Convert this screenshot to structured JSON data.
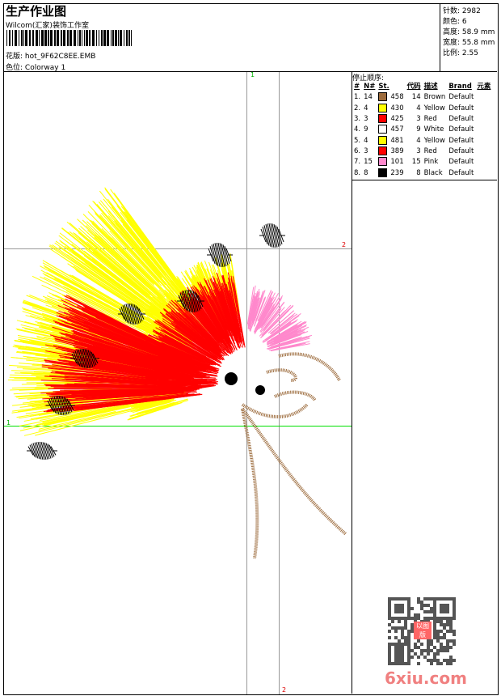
{
  "header": {
    "title": "生产作业图",
    "company": "Wilcom(汇家)装饰工作室",
    "design_label": "花版:",
    "design_value": "hot_9F62C8EE.EMB",
    "colorway_label": "色位:",
    "colorway_value": "Colorway 1"
  },
  "info": [
    {
      "label": "针数:",
      "value": "2982"
    },
    {
      "label": "颜色:",
      "value": "6"
    },
    {
      "label": "高度:",
      "value": "58.9 mm"
    },
    {
      "label": "宽度:",
      "value": "55.8 mm"
    },
    {
      "label": "比例:",
      "value": "2.55"
    }
  ],
  "stops": {
    "title": "停止顺序:",
    "columns": [
      "#",
      "N#",
      "St.",
      "代码",
      "描述",
      "Brand",
      "元素"
    ],
    "rows": [
      {
        "n": "1.",
        "needle": "14",
        "color": "#9c6b3c",
        "st": "458",
        "code": "14",
        "desc": "Brown",
        "brand": "Default"
      },
      {
        "n": "2.",
        "needle": "4",
        "color": "#ffff00",
        "st": "430",
        "code": "4",
        "desc": "Yellow",
        "brand": "Default"
      },
      {
        "n": "3.",
        "needle": "3",
        "color": "#ff0000",
        "st": "425",
        "code": "3",
        "desc": "Red",
        "brand": "Default"
      },
      {
        "n": "4.",
        "needle": "9",
        "color": "#ffffff",
        "st": "457",
        "code": "9",
        "desc": "White",
        "brand": "Default"
      },
      {
        "n": "5.",
        "needle": "4",
        "color": "#ffff00",
        "st": "481",
        "code": "4",
        "desc": "Yellow",
        "brand": "Default"
      },
      {
        "n": "6.",
        "needle": "3",
        "color": "#ff0000",
        "st": "389",
        "code": "3",
        "desc": "Red",
        "brand": "Default"
      },
      {
        "n": "7.",
        "needle": "15",
        "color": "#ff88cc",
        "st": "101",
        "code": "15",
        "desc": "Pink",
        "brand": "Default"
      },
      {
        "n": "8.",
        "needle": "8",
        "color": "#000000",
        "st": "239",
        "code": "8",
        "desc": "Black",
        "brand": "Default"
      }
    ]
  },
  "guides": {
    "v1": "1",
    "v2": "2",
    "h1": "1",
    "h2": "2"
  },
  "watermark": {
    "text": "6xiu.com",
    "stamp": "以图版"
  }
}
